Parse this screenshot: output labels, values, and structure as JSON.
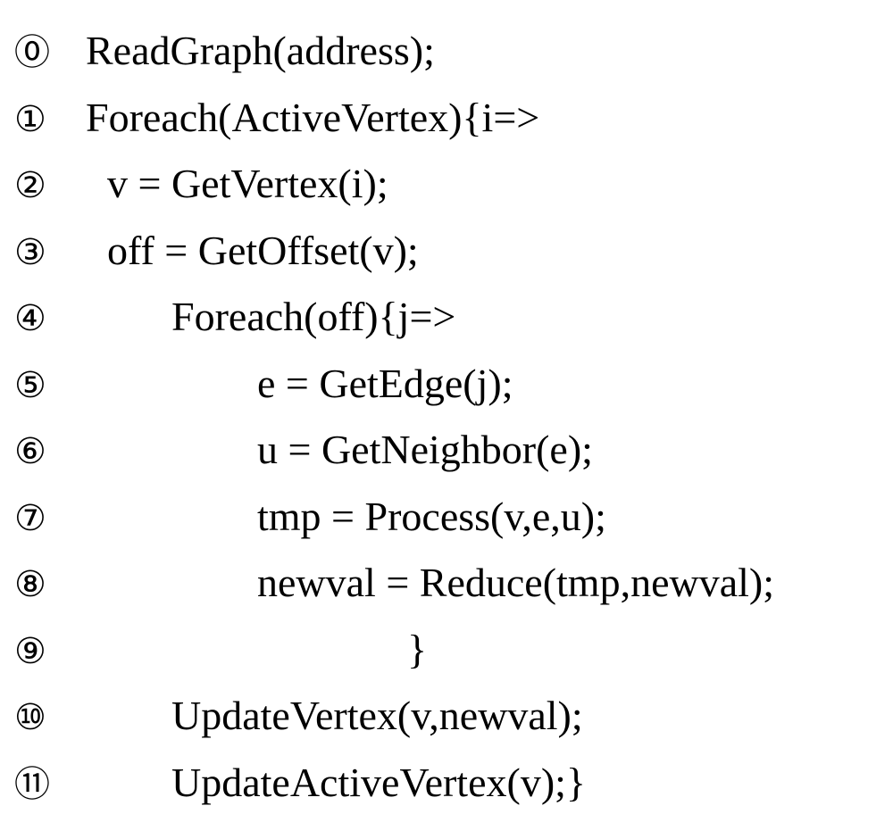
{
  "lines": [
    {
      "marker": "⓪",
      "indent": 0,
      "code": "ReadGraph(address);"
    },
    {
      "marker": "①",
      "indent": 0,
      "code": "Foreach(ActiveVertex){i=>"
    },
    {
      "marker": "②",
      "indent": 2,
      "code": "v = GetVertex(i);"
    },
    {
      "marker": "③",
      "indent": 2,
      "code": "off = GetOffset(v);"
    },
    {
      "marker": "④",
      "indent": 8,
      "code": "Foreach(off){j=>"
    },
    {
      "marker": "⑤",
      "indent": 16,
      "code": "e = GetEdge(j);"
    },
    {
      "marker": "⑥",
      "indent": 16,
      "code": "u = GetNeighbor(e);"
    },
    {
      "marker": "⑦",
      "indent": 16,
      "code": "tmp = Process(v,e,u);"
    },
    {
      "marker": "⑧",
      "indent": 16,
      "code": "newval = Reduce(tmp,newval);"
    },
    {
      "marker": "⑨",
      "indent": 30,
      "code": "}"
    },
    {
      "marker": "⑩",
      "indent": 8,
      "code": "UpdateVertex(v,newval);"
    },
    {
      "marker": "⑪",
      "indent": 8,
      "code": "UpdateActiveVertex(v);}"
    }
  ]
}
